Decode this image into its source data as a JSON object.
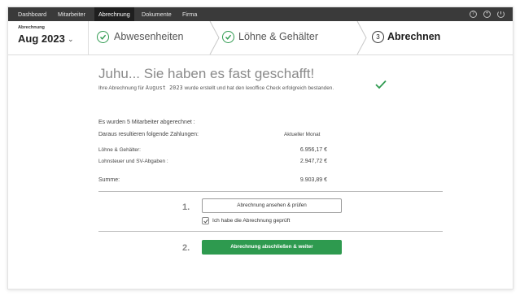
{
  "nav": {
    "items": [
      "Dashboard",
      "Mitarbeiter",
      "Abrechnung",
      "Dokumente",
      "Firma"
    ],
    "active": "Abrechnung",
    "icons": [
      "help-icon",
      "add-icon",
      "power-icon"
    ]
  },
  "period": {
    "label": "Abrechnung",
    "value": "Aug 2023"
  },
  "steps": [
    {
      "label": "Abwesenheiten",
      "state": "done"
    },
    {
      "label": "Löhne & Gehälter",
      "state": "done"
    },
    {
      "number": "3",
      "label": "Abrechnen",
      "state": "current"
    }
  ],
  "main": {
    "headline": "Juhu... Sie haben es fast geschafft!",
    "sub_before": "Ihre Abrechnung für",
    "sub_month": "August 2023",
    "sub_after": "wurde erstellt und hat den lexoffice Check erfolgreich bestanden.",
    "employees_text": "Es wurden 5 Mitarbeiter abgerechnet :",
    "payments_text": "Daraus resultieren folgende Zahlungen:",
    "column_header": "Aktueller Monat",
    "rows": [
      {
        "label": "Löhne & Gehälter:",
        "value": "6.956,17 €"
      },
      {
        "label": "Lohnsteuer und SV-Abgaben :",
        "value": "2.947,72 €"
      }
    ],
    "sum_label": "Summe:",
    "sum_value": "9.903,89 €",
    "step1_number": "1.",
    "review_button": "Abrechnung ansehen & prüfen",
    "checkbox_label": "Ich habe die Abrechnung geprüft",
    "checkbox_checked": true,
    "step2_number": "2.",
    "finish_button": "Abrechnung abschließen & weiter"
  },
  "colors": {
    "accent": "#2e9a4f",
    "nav_bg": "#3a3a3a"
  }
}
